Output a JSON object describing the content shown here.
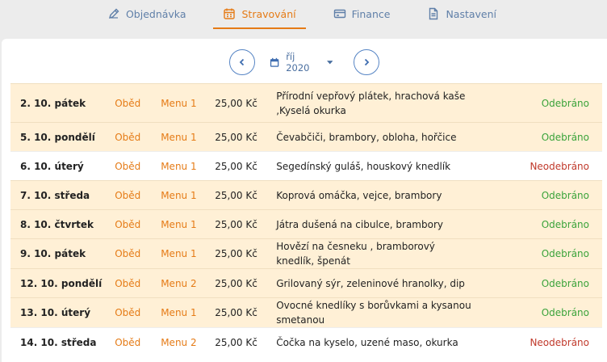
{
  "tabs": [
    {
      "label": "Objednávka",
      "icon": "pencil-icon",
      "active": false
    },
    {
      "label": "Stravování",
      "icon": "calendar-icon",
      "active": true
    },
    {
      "label": "Finance",
      "icon": "credit-card-icon",
      "active": false
    },
    {
      "label": "Nastavení",
      "icon": "document-icon",
      "active": false
    }
  ],
  "month": {
    "label": "říj 2020",
    "prev_icon": "chevron-left-icon",
    "next_icon": "chevron-right-icon"
  },
  "colors": {
    "accent": "#e57b16",
    "nav": "#5f7fa8",
    "taken_bg": "#fff0d6",
    "ok": "#3aa33a",
    "no": "#c0392b"
  },
  "rows": [
    {
      "date": "2. 10. pátek",
      "type": "Oběd",
      "menu": "Menu 1",
      "price": "25,00 Kč",
      "food": "Přírodní vepřový plátek, hrachová kaše ,Kyselá okurka",
      "status": "Odebráno",
      "taken": true
    },
    {
      "date": "5. 10. pondělí",
      "type": "Oběd",
      "menu": "Menu 1",
      "price": "25,00 Kč",
      "food": "Čevabčiči, brambory, obloha, hořčice",
      "status": "Odebráno",
      "taken": true
    },
    {
      "date": "6. 10. úterý",
      "type": "Oběd",
      "menu": "Menu 1",
      "price": "25,00 Kč",
      "food": "Segedínský guláš, houskový knedlík",
      "status": "Neodebráno",
      "taken": false
    },
    {
      "date": "7. 10. středa",
      "type": "Oběd",
      "menu": "Menu 1",
      "price": "25,00 Kč",
      "food": "Koprová omáčka, vejce, brambory",
      "status": "Odebráno",
      "taken": true
    },
    {
      "date": "8. 10. čtvrtek",
      "type": "Oběd",
      "menu": "Menu 1",
      "price": "25,00 Kč",
      "food": "Játra dušená na cibulce, brambory",
      "status": "Odebráno",
      "taken": true
    },
    {
      "date": "9. 10. pátek",
      "type": "Oběd",
      "menu": "Menu 1",
      "price": "25,00 Kč",
      "food": "Hovězí na česneku , bramborový knedlík, špenát",
      "status": "Odebráno",
      "taken": true
    },
    {
      "date": "12. 10. pondělí",
      "type": "Oběd",
      "menu": "Menu 2",
      "price": "25,00 Kč",
      "food": "Grilovaný sýr, zeleninové hranolky, dip",
      "status": "Odebráno",
      "taken": true
    },
    {
      "date": "13. 10. úterý",
      "type": "Oběd",
      "menu": "Menu 1",
      "price": "25,00 Kč",
      "food": "Ovocné knedlíky s borůvkami a kysanou smetanou",
      "status": "Odebráno",
      "taken": true
    },
    {
      "date": "14. 10. středa",
      "type": "Oběd",
      "menu": "Menu 2",
      "price": "25,00 Kč",
      "food": "Čočka na kyselo, uzené maso, okurka",
      "status": "Neodebráno",
      "taken": false
    }
  ]
}
